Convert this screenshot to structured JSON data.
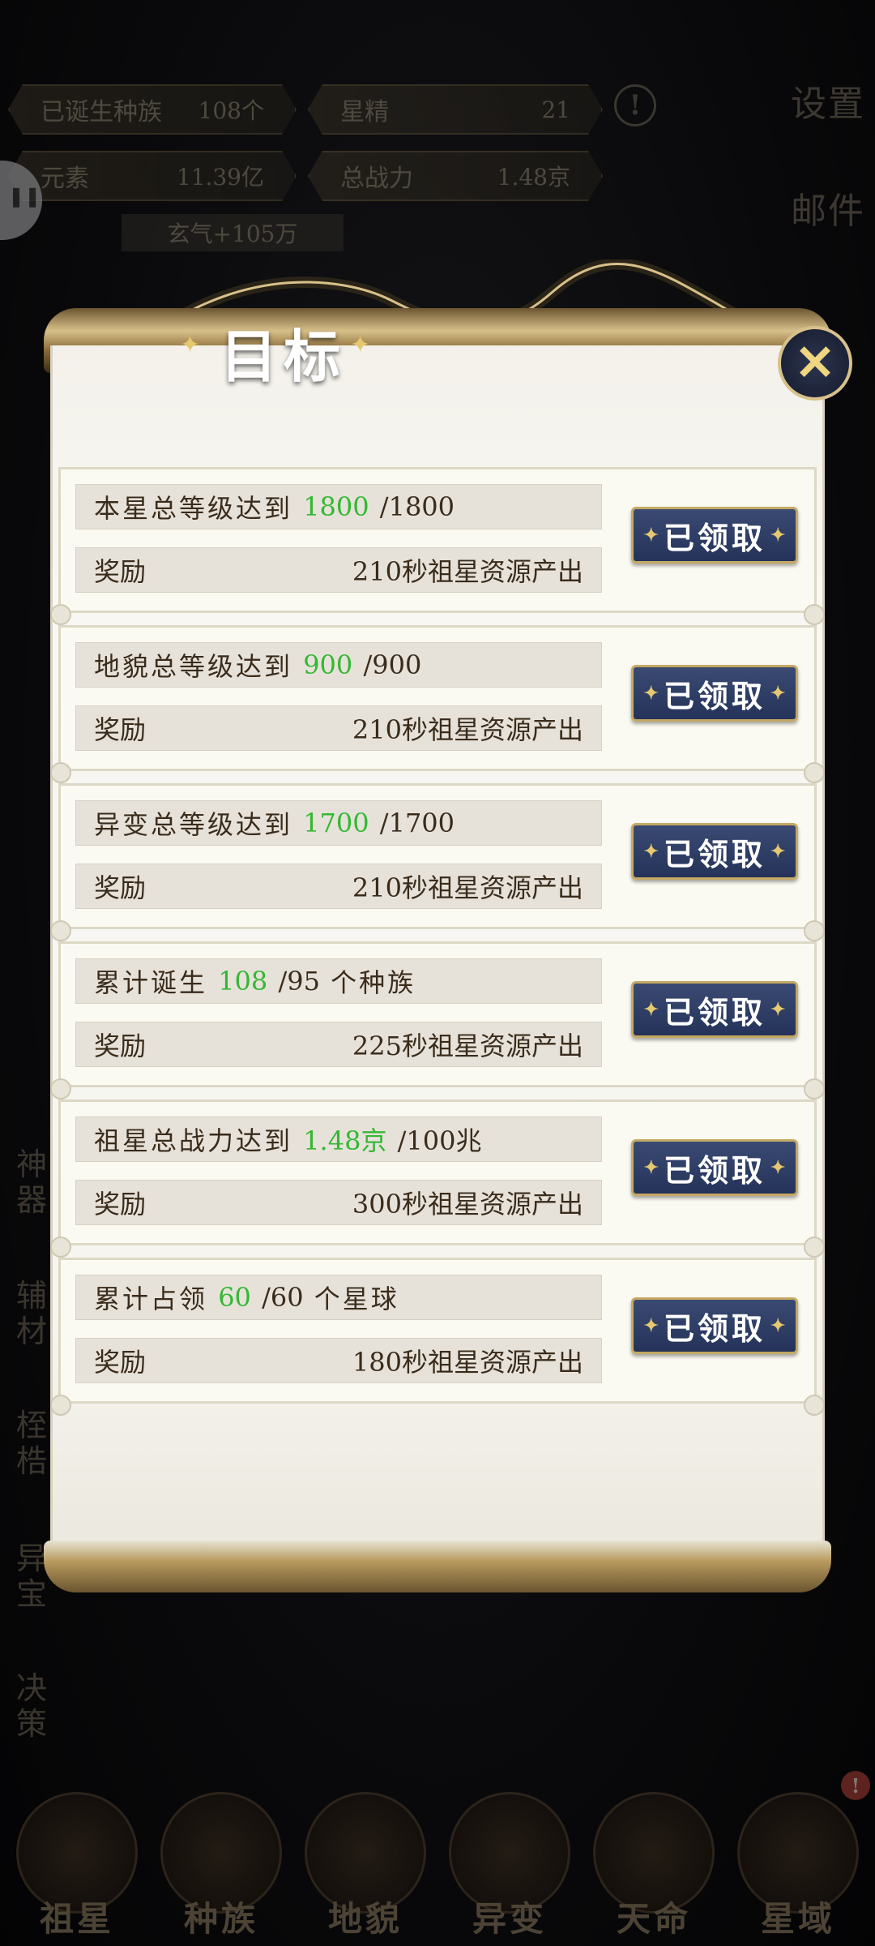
{
  "hud": {
    "born_races_label": "已诞生种族",
    "born_races_value": "108个",
    "star_essence_label": "星精",
    "star_essence_value": "21",
    "element_label": "元素",
    "element_value": "11.39亿",
    "total_power_label": "总战力",
    "total_power_value": "1.48京",
    "xuanqi": "玄气+105万",
    "right_menu": [
      "设置",
      "邮件"
    ],
    "left_menu": [
      "神器",
      "辅材",
      "桎梏",
      "异宝",
      "决策"
    ]
  },
  "modal": {
    "title": "目标",
    "close_icon": "close-icon",
    "goals": [
      {
        "prefix": "本星总等级达到",
        "current": "1800",
        "target": "/1800",
        "suffix": "",
        "reward_label": "奖励",
        "reward": "210秒祖星资源产出",
        "button": "已领取"
      },
      {
        "prefix": "地貌总等级达到",
        "current": "900",
        "target": "/900",
        "suffix": "",
        "reward_label": "奖励",
        "reward": "210秒祖星资源产出",
        "button": "已领取"
      },
      {
        "prefix": "异变总等级达到",
        "current": "1700",
        "target": "/1700",
        "suffix": "",
        "reward_label": "奖励",
        "reward": "210秒祖星资源产出",
        "button": "已领取"
      },
      {
        "prefix": "累计诞生",
        "current": "108",
        "target": "/95",
        "suffix": "个种族",
        "reward_label": "奖励",
        "reward": "225秒祖星资源产出",
        "button": "已领取"
      },
      {
        "prefix": "祖星总战力达到",
        "current": "1.48京",
        "target": "/100兆",
        "suffix": "",
        "reward_label": "奖励",
        "reward": "300秒祖星资源产出",
        "button": "已领取"
      },
      {
        "prefix": "累计占领",
        "current": "60",
        "target": "/60",
        "suffix": "个星球",
        "reward_label": "奖励",
        "reward": "180秒祖星资源产出",
        "button": "已领取"
      }
    ]
  },
  "navbar": {
    "items": [
      "祖星",
      "种族",
      "地貌",
      "异变",
      "天命",
      "星域"
    ],
    "badge": "!"
  },
  "colors": {
    "progress_green": "#34b834",
    "button_navy": "#2c3a62",
    "gold": "#c4a864"
  }
}
